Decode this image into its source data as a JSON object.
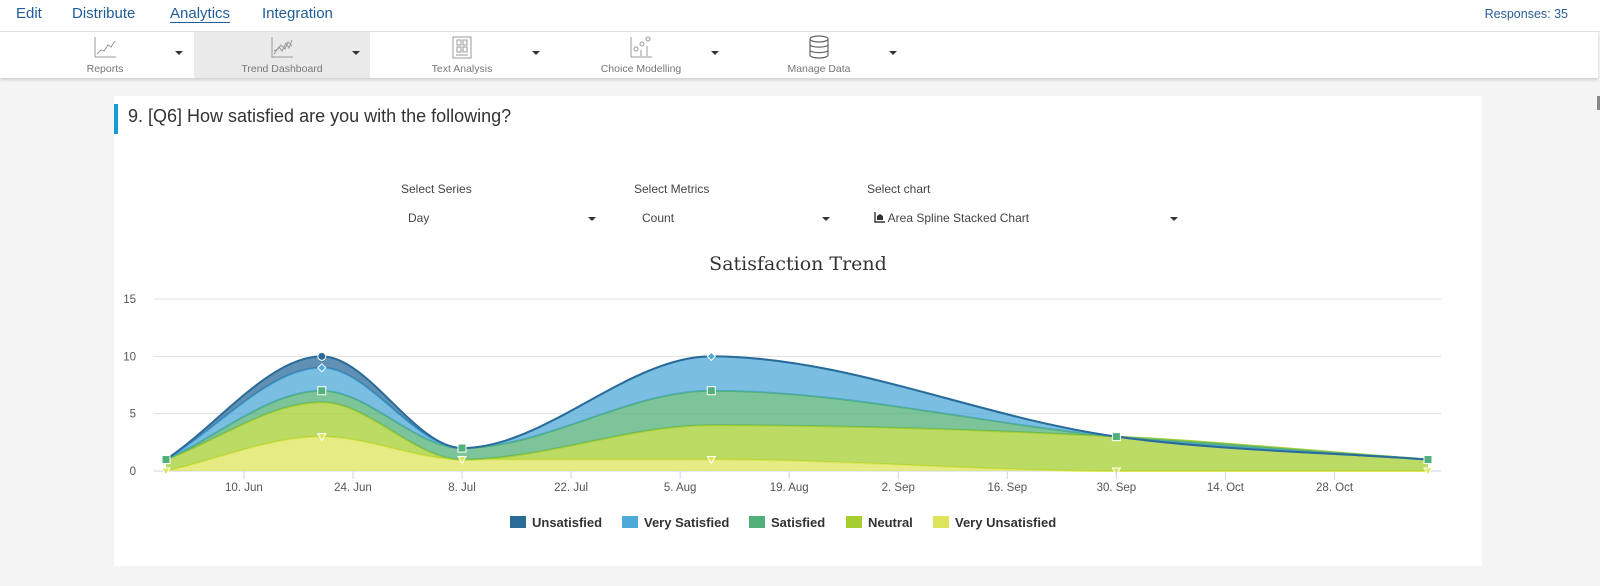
{
  "topnav": {
    "tabs": [
      {
        "label": "Edit",
        "active": false
      },
      {
        "label": "Distribute",
        "active": false
      },
      {
        "label": "Analytics",
        "active": true
      },
      {
        "label": "Integration",
        "active": false
      }
    ],
    "responses": "Responses: 35"
  },
  "toolbar": {
    "items": [
      {
        "label": "Reports",
        "icon": "line-chart-icon",
        "active": false
      },
      {
        "label": "Trend Dashboard",
        "icon": "trend-chart-icon",
        "active": true
      },
      {
        "label": "Text Analysis",
        "icon": "text-analysis-icon",
        "active": false
      },
      {
        "label": "Choice Modelling",
        "icon": "choice-modelling-icon",
        "active": false
      },
      {
        "label": "Manage Data",
        "icon": "database-icon",
        "active": false
      }
    ]
  },
  "question": {
    "title": "9. [Q6] How satisfied are you with the following?"
  },
  "controls": {
    "series": {
      "label": "Select Series",
      "value": "Day"
    },
    "metrics": {
      "label": "Select Metrics",
      "value": "Count"
    },
    "chart": {
      "label": "Select chart",
      "value": "Area Spline Stacked Chart",
      "icon": "area-chart-icon"
    }
  },
  "colors": {
    "accent": "#1a9ad6",
    "nav_text": "#1f5c99"
  },
  "chart_data": {
    "type": "area",
    "stacked": true,
    "spline": true,
    "title": "Satisfaction Trend",
    "xlabel": "",
    "ylabel": "",
    "ylim": [
      0,
      15
    ],
    "yticks": [
      0,
      5,
      10,
      15
    ],
    "grid": true,
    "legend_position": "bottom",
    "x": [
      "2019-05-31",
      "2019-06-20",
      "2019-07-08",
      "2019-08-09",
      "2019-09-30",
      "2019-11-09"
    ],
    "xlim": [
      "2019-05-31",
      "2019-11-09"
    ],
    "xticks": [
      {
        "date": "2019-06-10",
        "label": "10. Jun"
      },
      {
        "date": "2019-06-24",
        "label": "24. Jun"
      },
      {
        "date": "2019-07-08",
        "label": "8. Jul"
      },
      {
        "date": "2019-07-22",
        "label": "22. Jul"
      },
      {
        "date": "2019-08-05",
        "label": "5. Aug"
      },
      {
        "date": "2019-08-19",
        "label": "19. Aug"
      },
      {
        "date": "2019-09-02",
        "label": "2. Sep"
      },
      {
        "date": "2019-09-16",
        "label": "16. Sep"
      },
      {
        "date": "2019-09-30",
        "label": "30. Sep"
      },
      {
        "date": "2019-10-14",
        "label": "14. Oct"
      },
      {
        "date": "2019-10-28",
        "label": "28. Oct"
      }
    ],
    "series": [
      {
        "name": "Unsatisfied",
        "color": "#2b6b9a",
        "marker": "circle",
        "values": [
          0,
          1,
          0,
          0,
          0,
          0
        ]
      },
      {
        "name": "Very Satisfied",
        "color": "#4ea8d8",
        "marker": "diamond",
        "values": [
          0,
          2,
          0,
          3,
          0,
          0
        ]
      },
      {
        "name": "Satisfied",
        "color": "#52b07a",
        "marker": "square",
        "values": [
          0,
          1,
          1,
          3,
          0,
          0
        ]
      },
      {
        "name": "Neutral",
        "color": "#a5cf30",
        "marker": "triangle",
        "values": [
          1,
          3,
          0,
          3,
          3,
          1
        ]
      },
      {
        "name": "Very Unsatisfied",
        "color": "#dde55a",
        "marker": "triangle-down",
        "values": [
          0,
          3,
          1,
          1,
          0,
          0
        ]
      }
    ]
  }
}
